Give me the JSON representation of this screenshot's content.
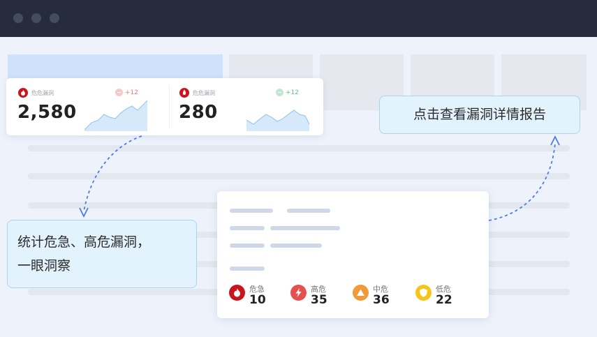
{
  "stats": [
    {
      "label": "危危漏洞",
      "value": "2,580",
      "trend": "+12",
      "trend_color": "#e8787c",
      "icon": "fire-icon"
    },
    {
      "label": "危危漏洞",
      "value": "280",
      "trend": "+12",
      "trend_color": "#5cc38a",
      "icon": "flame-icon"
    }
  ],
  "callouts": {
    "report": "点击查看漏洞详情报告",
    "stats_line1": "统计危急、高危漏洞，",
    "stats_line2": "一眼洞察"
  },
  "severity": [
    {
      "label": "危急",
      "count": "10",
      "color": "#c8161d",
      "icon": "fire-icon"
    },
    {
      "label": "高危",
      "count": "35",
      "color": "#e45050",
      "icon": "lightning-icon"
    },
    {
      "label": "中危",
      "count": "36",
      "color": "#f29a3a",
      "icon": "triangle-icon"
    },
    {
      "label": "低危",
      "count": "22",
      "color": "#f5c518",
      "icon": "shield-icon"
    }
  ],
  "colors": {
    "titlebar": "#262c3c",
    "accent_blue": "#4b7be8",
    "callout_bg": "#e3f3fd",
    "spark_fill": "#d6e9fb",
    "spark_line": "#9cc8f0"
  }
}
